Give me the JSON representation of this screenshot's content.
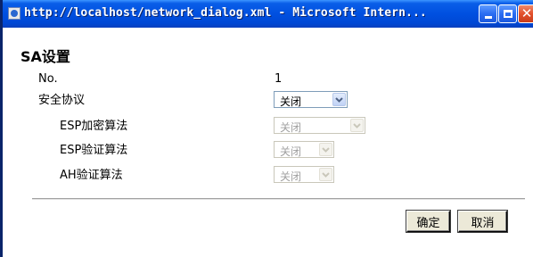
{
  "window": {
    "title": "http://localhost/network_dialog.xml - Microsoft Intern..."
  },
  "dialog": {
    "title": "SA设置",
    "fields": {
      "no_label": "No.",
      "no_value": "1",
      "protocol_label": "安全协议",
      "protocol_value": "关闭",
      "esp_enc_label": "ESP加密算法",
      "esp_enc_value": "关闭",
      "esp_auth_label": "ESP验证算法",
      "esp_auth_value": "关闭",
      "ah_auth_label": "AH验证算法",
      "ah_auth_value": "关闭"
    },
    "buttons": {
      "ok": "确定",
      "cancel": "取消"
    }
  },
  "colors": {
    "titlebar": "#0050e0",
    "disabled_text": "#a0a0a0",
    "button_face": "#ece9d8"
  }
}
